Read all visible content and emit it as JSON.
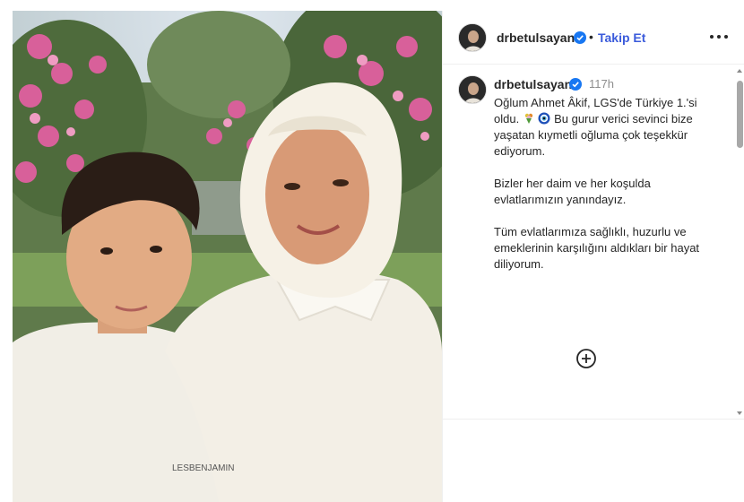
{
  "post": {
    "username": "drbetulsayan",
    "follow_label": "Takip Et",
    "separator": "•",
    "time": "117h",
    "caption": {
      "line1a": "Oğlum Ahmet Âkif, LGS'de Türkiye 1.'si oldu.",
      "line1b": "Bu gurur verici sevinci bize yaşatan kıymetli oğluma çok teşekkür ediyorum.",
      "para2": "Bizler her daim ve her koşulda evlatlarımızın yanındayız.",
      "para3": "Tüm evlatlarımıza sağlıklı, huzurlu ve emeklerinin karşılığını aldıkları bir hayat diliyorum."
    },
    "shirt_text": "LESBENJAMIN"
  },
  "icons": {
    "verified": "verified-badge-icon",
    "more": "more-options-icon",
    "plus": "load-more-comments-icon",
    "emoji1": "bouquet-emoji-icon",
    "emoji2": "evil-eye-emoji-icon"
  },
  "colors": {
    "follow": "#3b5bdb",
    "verified": "#1877f2",
    "muted": "#8e8e8e",
    "text": "#262626"
  }
}
